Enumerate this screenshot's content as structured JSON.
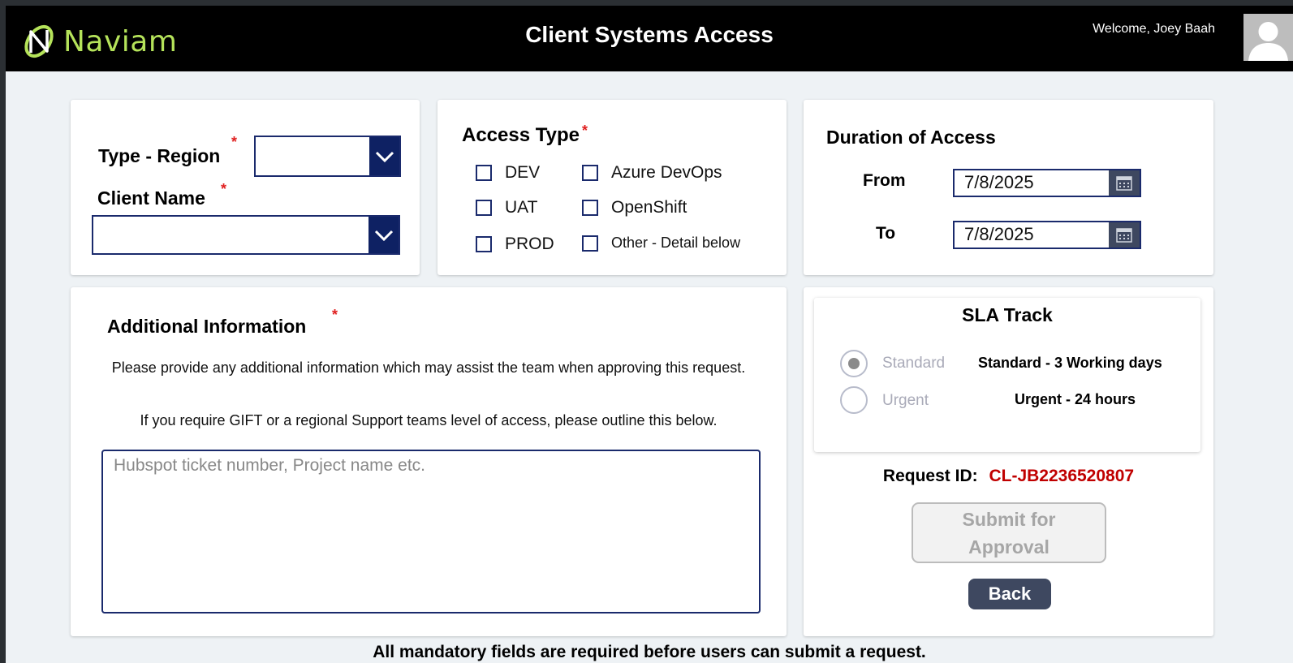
{
  "header": {
    "brand": "Naviam",
    "title": "Client Systems Access",
    "welcome": "Welcome, Joey Baah"
  },
  "region_card": {
    "type_region_label": "Type - Region",
    "client_name_label": "Client Name",
    "required_mark": "*",
    "type_region_value": "",
    "client_name_value": ""
  },
  "access_type": {
    "label": "Access Type",
    "required_mark": "*",
    "options": [
      {
        "label": "DEV",
        "checked": false
      },
      {
        "label": "UAT",
        "checked": false
      },
      {
        "label": "PROD",
        "checked": false
      },
      {
        "label": "Azure DevOps",
        "checked": false
      },
      {
        "label": "OpenShift",
        "checked": false
      },
      {
        "label": "Other - Detail below",
        "checked": false
      }
    ]
  },
  "duration": {
    "label": "Duration of Access",
    "from_label": "From",
    "to_label": "To",
    "from_value": "7/8/2025",
    "to_value": "7/8/2025"
  },
  "additional": {
    "label": "Additional Information",
    "required_mark": "*",
    "help_text_1": "Please provide any additional information which may assist the team when approving this request.",
    "help_text_2": "If you require GIFT or a regional Support teams level of access, please outline this below.",
    "placeholder": "Hubspot ticket number, Project name etc.",
    "value": ""
  },
  "sla": {
    "title": "SLA Track",
    "options": [
      {
        "label": "Standard",
        "description": "Standard - 3 Working days",
        "selected": true
      },
      {
        "label": "Urgent",
        "description": "Urgent - 24 hours",
        "selected": false
      }
    ]
  },
  "request": {
    "id_label": "Request ID:",
    "id_value": "CL-JB2236520807",
    "id_color": "#c00000"
  },
  "actions": {
    "submit_label": "Submit for Approval",
    "back_label": "Back"
  },
  "footer": {
    "note": "All mandatory fields are required before users can submit a request."
  },
  "colors": {
    "header_bg": "#000000",
    "brand_green": "#b5e35a",
    "navy": "#0e2163",
    "button_slate": "#3e4860"
  }
}
